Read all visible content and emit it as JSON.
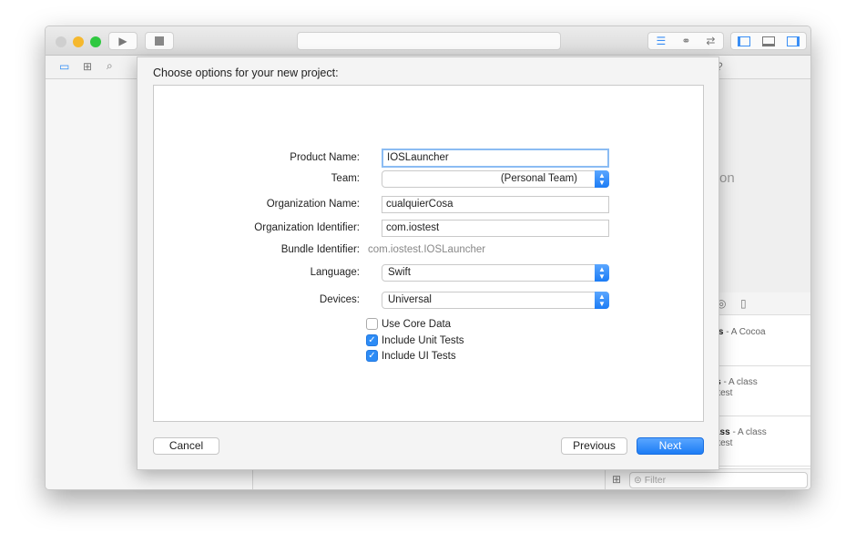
{
  "window": {
    "toolbar": {
      "run_icon": "play-icon",
      "stop_icon": "stop-icon"
    }
  },
  "sheet": {
    "title": "Choose options for your new project:",
    "fields": {
      "product_name": {
        "label": "Product Name:",
        "value": "IOSLauncher"
      },
      "team": {
        "label": "Team:",
        "value": "(Personal Team)"
      },
      "organization_name": {
        "label": "Organization Name:",
        "value": "cualquierCosa"
      },
      "organization_identifier": {
        "label": "Organization Identifier:",
        "value": "com.iostest"
      },
      "bundle_identifier": {
        "label": "Bundle Identifier:",
        "value": "com.iostest.IOSLauncher"
      },
      "language": {
        "label": "Language:",
        "value": "Swift"
      },
      "devices": {
        "label": "Devices:",
        "value": "Universal"
      }
    },
    "checkboxes": [
      {
        "label": "Use Core Data",
        "checked": false
      },
      {
        "label": "Include Unit Tests",
        "checked": true
      },
      {
        "label": "Include UI Tests",
        "checked": true
      }
    ],
    "buttons": {
      "cancel": "Cancel",
      "previous": "Previous",
      "next": "Next"
    }
  },
  "inspector": {
    "placeholder_fragment": "ction"
  },
  "library": {
    "items": [
      {
        "title": "lass",
        "desc": " - A Cocoa",
        "desc2": ""
      },
      {
        "title": "ass",
        "desc": " - A class",
        "desc2": "nit test"
      },
      {
        "title": "Class",
        "desc": " - A class",
        "desc2": "nit test"
      }
    ],
    "filter_placeholder": "Filter"
  },
  "colors": {
    "accent": "#1c7cf5",
    "close": "#cfcfcf",
    "minimize": "#f5b82e",
    "zoom": "#2fc840"
  }
}
